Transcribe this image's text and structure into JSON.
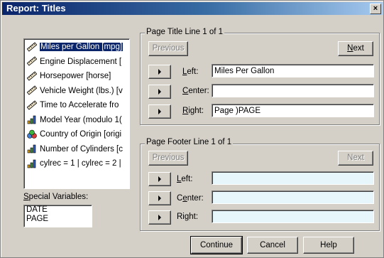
{
  "window": {
    "title": "Report: Titles",
    "close_symbol": "×"
  },
  "variables": {
    "items": [
      {
        "label": "Miles per Gallon [mpg]",
        "icon": "scale-ruler-icon",
        "selected": true
      },
      {
        "label": "Engine Displacement [",
        "icon": "scale-ruler-icon"
      },
      {
        "label": "Horsepower [horse]",
        "icon": "scale-ruler-icon"
      },
      {
        "label": "Vehicle Weight (lbs.) [v",
        "icon": "scale-ruler-icon"
      },
      {
        "label": "Time to Accelerate fro",
        "icon": "scale-ruler-icon"
      },
      {
        "label": "Model Year (modulo 1(",
        "icon": "ordinal-bar-icon"
      },
      {
        "label": "Country of Origin [origi",
        "icon": "nominal-circles-icon"
      },
      {
        "label": "Number of Cylinders [c",
        "icon": "ordinal-bar-icon"
      },
      {
        "label": "cylrec = 1 | cylrec = 2 |",
        "icon": "ordinal-bar-icon"
      }
    ]
  },
  "special": {
    "label": "Special Variables:",
    "items": [
      "DATE",
      "PAGE"
    ]
  },
  "title_group": {
    "legend": "Page Title Line 1 of 1",
    "previous": "Previous",
    "next": "Next",
    "left_label": "Left:",
    "center_label": "Center:",
    "right_label": "Right:",
    "left_value": "Miles Per Gallon",
    "center_value": "",
    "right_value": "Page )PAGE"
  },
  "footer_group": {
    "legend": "Page Footer Line 1 of 1",
    "previous": "Previous",
    "next": "Next",
    "left_label": "Left:",
    "center_label": "Center:",
    "right_label": "Right:",
    "left_value": "",
    "center_value": "",
    "right_value": ""
  },
  "buttons": {
    "continue": "Continue",
    "cancel": "Cancel",
    "help": "Help"
  },
  "colors": {
    "selection": "#0a246a",
    "face": "#d4d0c8",
    "disabled_field": "#e6f6fb"
  }
}
